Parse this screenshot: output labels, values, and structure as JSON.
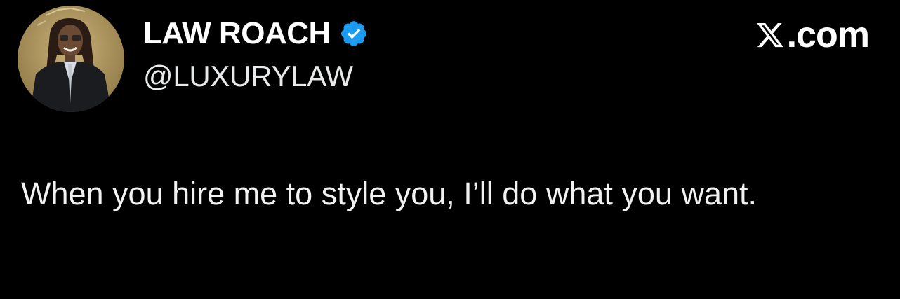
{
  "tweet": {
    "author": {
      "display_name": "LAW ROACH",
      "handle": "@LUXURYLAW",
      "verified": true,
      "avatar_icon": "profile-photo"
    },
    "brand": {
      "logo_icon": "x-logo-icon",
      "suffix": ".com"
    },
    "text": "When you hire me to style you, I’ll do what you want."
  },
  "colors": {
    "background": "#000000",
    "text": "#ffffff",
    "verified_badge": "#1d9bf0"
  }
}
